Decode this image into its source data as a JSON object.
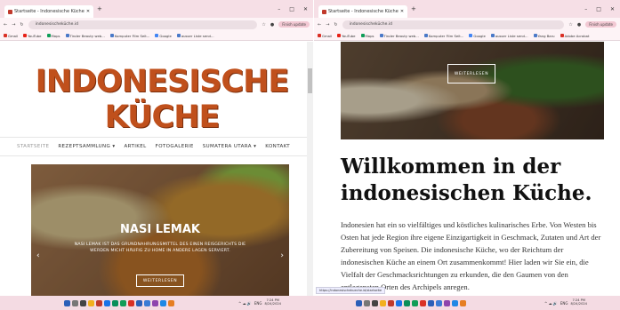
{
  "colors": {
    "accent": "#c0501c",
    "tab_bar": "#f6dfe6",
    "taskbar": "#f4dbe3"
  },
  "browser": {
    "tab_title": "Startseite - Indonesische Küche",
    "new_tab": "+",
    "url": "indonesischeküche.id",
    "profile_button": "Finish update",
    "window_controls": [
      "–",
      "□",
      "✕"
    ],
    "bookmarks": [
      "Gmail",
      "YouTube",
      "Maps",
      "Tiroler Beauty web...",
      "Komputer Film Seit...",
      "Google",
      "ausser Liste send...",
      "Yang Baru",
      "Adobe Acrobat"
    ]
  },
  "left": {
    "logo": "INDONESISCHE KÜCHE",
    "nav": [
      "STARTSEITE",
      "REZEPTSAMMLUNG ▾",
      "ARTIKEL",
      "FOTOGALERIE",
      "SUMATERA UTARA ▾",
      "KONTAKT"
    ],
    "hero": {
      "title": "NASI LEMAK",
      "text": "NASI LEMAK IST DAS GRUNDNAHRUNGSMITTEL DES EINEN REISGERICHTS DIE WERDEN MICHT HÄUFIG ZU HOME IN ANDERE LAGEN SERVIERT.",
      "button": "WEITERLESEN",
      "prev": "‹",
      "next": "›"
    }
  },
  "right": {
    "photo_button": "WEITERLESEN",
    "heading": "Willkommen in der indonesischen Küche.",
    "paragraph": "Indonesien hat ein so vielfältiges und köstliches kulinarisches Erbe. Von Westen bis Osten hat jede Region ihre eigene Einzigartigkeit in Geschmack, Zutaten und Art der Zubereitung von Speisen. Die indonesische Küche, wo der Reichtum der indonesischen Küche an einem Ort zusammenkommt! Hier laden wir Sie ein, die Vielfalt der Geschmacksrichtungen zu erkunden, die den Gaumen von den entlegensten Orten des Archipels anregen.",
    "status_url": "https://indonesischekueche.id/startseite"
  },
  "taskbar": {
    "icon_colors": [
      "#2b5fb8",
      "#777777",
      "#444444",
      "#f2b01e",
      "#c0392b",
      "#1a73e8",
      "#0a8f5b",
      "#0f9d58",
      "#d93025",
      "#2b5fb8",
      "#3a7bd5",
      "#8e44ad",
      "#1e88e5",
      "#e67e22"
    ],
    "tray": "^ ☁ 🔊",
    "lang": "ENG",
    "time": "7:24 PM",
    "date": "8/24/2024"
  }
}
